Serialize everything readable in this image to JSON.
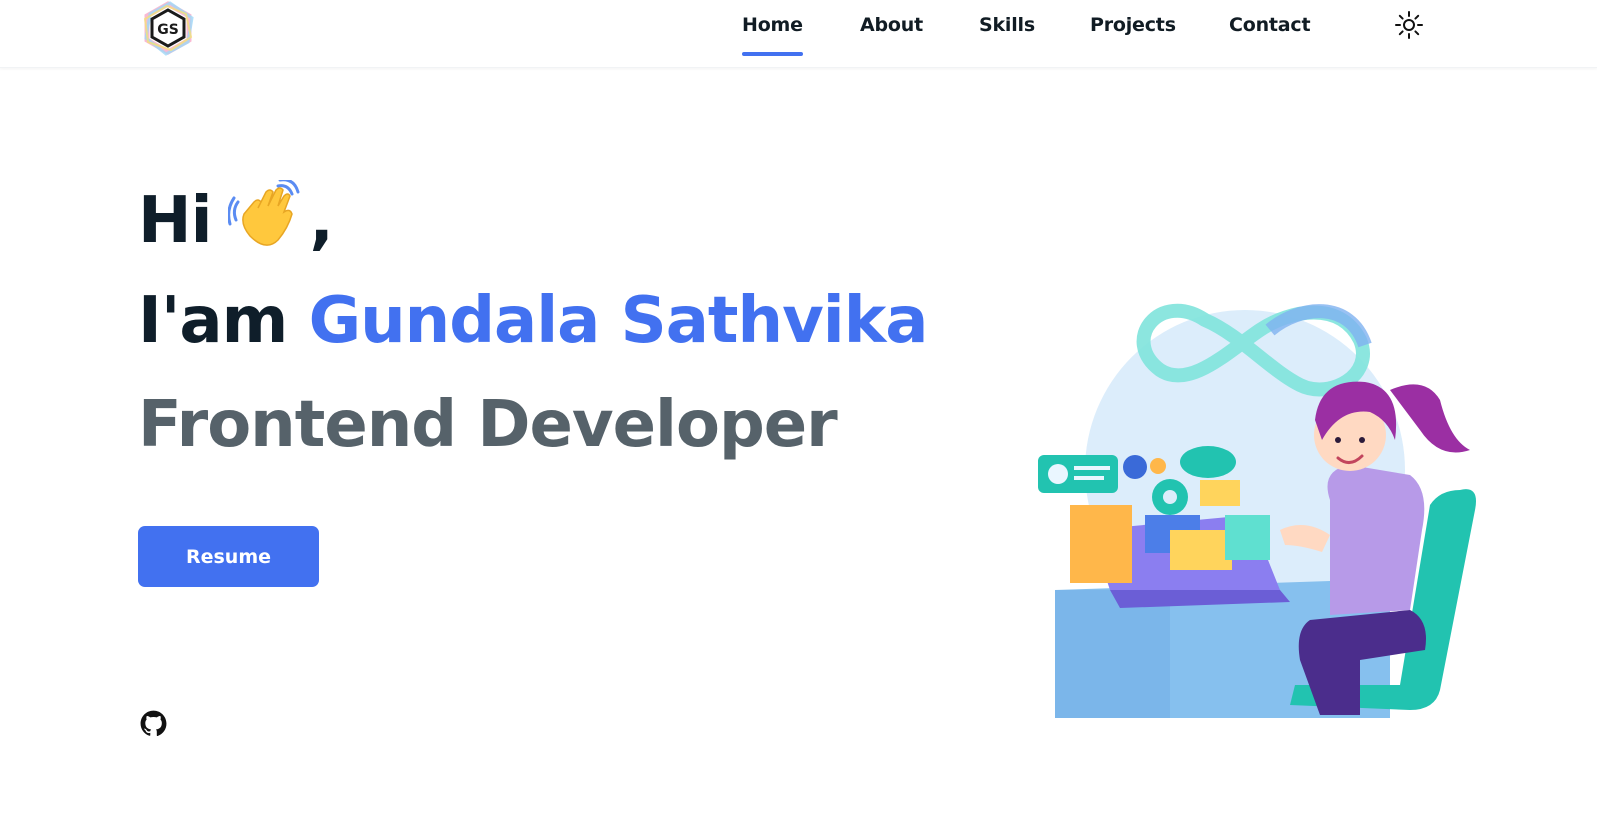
{
  "header": {
    "logo_icon": "gs-monogram-logo",
    "nav": [
      {
        "label": "Home",
        "active": true
      },
      {
        "label": "About",
        "active": false
      },
      {
        "label": "Skills",
        "active": false
      },
      {
        "label": "Projects",
        "active": false
      },
      {
        "label": "Contact",
        "active": false
      }
    ],
    "theme_toggle_icon": "sun-icon"
  },
  "hero": {
    "greeting": "Hi",
    "greeting_suffix": ",",
    "wave_icon": "waving-hand-emoji",
    "intro": "I'am",
    "name": "Gundala Sathvika",
    "role": "Frontend Developer",
    "resume_label": "Resume",
    "social_icon": "github-icon",
    "illustration": "developer-at-laptop-illustration"
  },
  "colors": {
    "accent": "#4271f0",
    "heading": "#0f1e2a",
    "role_text": "#56626a"
  }
}
